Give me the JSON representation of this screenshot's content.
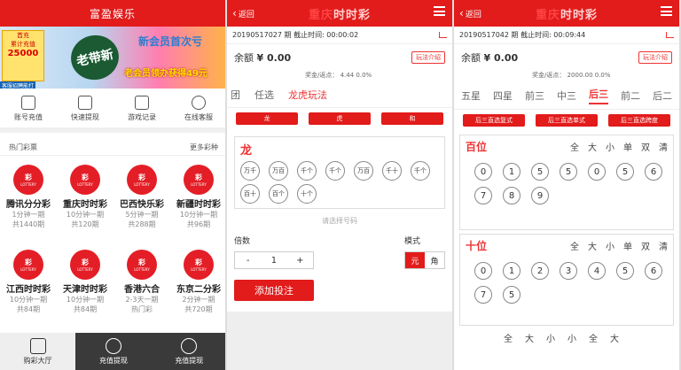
{
  "p1": {
    "title": "富盈娱乐",
    "banner": {
      "left_lines": [
        "首充",
        "累计充值",
        "25000"
      ],
      "headline": "新会员首次亏",
      "badge": "老带新",
      "bottom": "老会员领办获得49元",
      "tag": "客服招聘能打"
    },
    "quick": [
      "账号充值",
      "快速提现",
      "游戏记录",
      "在线客服"
    ],
    "hot_label": "热门彩票",
    "more_label": "更多彩种",
    "logo_text": "彩",
    "logo_sub": "LOTTERY",
    "games_row1": [
      {
        "name": "腾讯分分彩",
        "period": "1分钟一期",
        "count": "共1440期"
      },
      {
        "name": "重庆时时彩",
        "period": "10分钟一期",
        "count": "共120期"
      },
      {
        "name": "巴西快乐彩",
        "period": "5分钟一期",
        "count": "共288期"
      },
      {
        "name": "新疆时时彩",
        "period": "10分钟一期",
        "count": "共96期"
      }
    ],
    "games_row2": [
      {
        "name": "江西时时彩",
        "period": "10分钟一期",
        "count": "共84期"
      },
      {
        "name": "天津时时彩",
        "period": "10分钟一期",
        "count": "共84期"
      },
      {
        "name": "香港六合",
        "period": "2-3天一期",
        "count": "热门彩"
      },
      {
        "name": "东京二分彩",
        "period": "2分钟一期",
        "count": "共720期"
      }
    ],
    "tabs": [
      "购彩大厅",
      "充值提现",
      "充值提现"
    ]
  },
  "p2": {
    "back": "返回",
    "title_prefix": "重庆",
    "title": "时时彩",
    "issue": "20190517027 期 截止时间: 00:00:02",
    "balance_label": "余额",
    "balance": "¥ 0.00",
    "intro": "玩法介绍",
    "odds": "奖金/返点： 4.44      0.0%",
    "playtabs": [
      "团",
      "任选",
      "龙虎玩法"
    ],
    "subbtns": [
      "龙",
      "虎",
      "和"
    ],
    "pick_head": "龙",
    "chips": [
      "万千",
      "万百",
      "千个",
      "千个",
      "万百",
      "千十",
      "千个",
      "百十",
      "百个",
      "十个"
    ],
    "hint": "请选择号码",
    "multiple_label": "倍数",
    "mode_label": "模式",
    "stepper": [
      "-",
      "1",
      "+"
    ],
    "modes": [
      "元",
      "角"
    ],
    "add_label": "添加投注"
  },
  "p3": {
    "back": "返回",
    "title_prefix": "重庆",
    "title": "时时彩",
    "issue": "20190517042 期 截止时间: 00:09:44",
    "balance_label": "余额",
    "balance": "¥ 0.00",
    "intro": "玩法介绍",
    "odds": "奖金/返点： 2000.00      0.0%",
    "positions": [
      "五星",
      "四星",
      "前三",
      "中三",
      "后三",
      "前二",
      "后二"
    ],
    "subbtns": [
      "后三直选复式",
      "后三直选单式",
      "后三直选跨度"
    ],
    "ops": [
      "全",
      "大",
      "小",
      "单",
      "双",
      "清"
    ],
    "hundreds": {
      "label": "百位",
      "balls": [
        "0",
        "1",
        "5",
        "5",
        "0",
        "5",
        "6",
        "7",
        "8",
        "9"
      ]
    },
    "tens": {
      "label": "十位",
      "balls": [
        "0",
        "1",
        "2",
        "3",
        "4",
        "5",
        "6",
        "7",
        "5"
      ]
    },
    "bottom_ops": [
      "全",
      "大",
      "小",
      "小",
      "全",
      "大"
    ]
  },
  "colors": {
    "accent": "#e21b1b",
    "tab_dark": "#3a3a3a"
  }
}
